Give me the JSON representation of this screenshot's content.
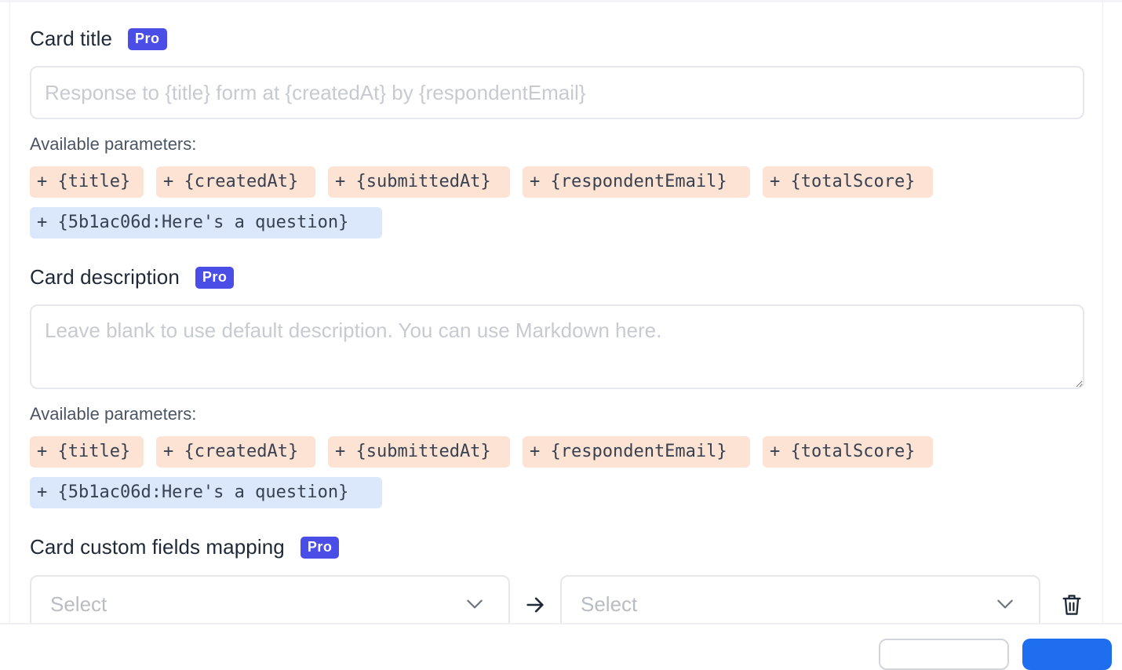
{
  "colors": {
    "pro_badge": "#4a4de6",
    "chip_default": "#fde3d3",
    "chip_question": "#dbe7fb",
    "primary_button": "#1f6ef0"
  },
  "card_title": {
    "label": "Card title",
    "badge": "Pro",
    "placeholder": "Response to {title} form at {createdAt} by {respondentEmail}",
    "value": "",
    "params_label": "Available parameters:",
    "params": [
      "+ {title}",
      "+ {createdAt}",
      "+ {submittedAt}",
      "+ {respondentEmail}",
      "+ {totalScore}",
      "+ {5b1ac06d:Here's a question}"
    ]
  },
  "card_description": {
    "label": "Card description",
    "badge": "Pro",
    "placeholder": "Leave blank to use default description. You can use Markdown here.",
    "value": "",
    "params_label": "Available parameters:",
    "params": [
      "+ {title}",
      "+ {createdAt}",
      "+ {submittedAt}",
      "+ {respondentEmail}",
      "+ {totalScore}",
      "+ {5b1ac06d:Here's a question}"
    ]
  },
  "custom_fields": {
    "label": "Card custom fields mapping",
    "badge": "Pro",
    "source_select_placeholder": "Select",
    "target_select_placeholder": "Select",
    "arrow_icon": "arrow-right-icon",
    "delete_icon": "trash-icon"
  }
}
